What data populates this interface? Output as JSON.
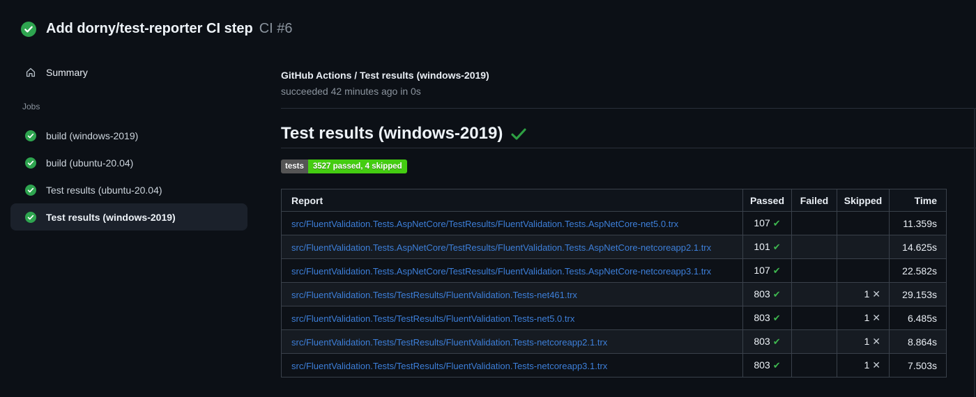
{
  "colors": {
    "page_bg": "#0c1016",
    "link": "#3d7fd9",
    "green_circle": "#2ea44f",
    "check_green": "#3fb950",
    "heading_check_green": "#2ea043",
    "badge_label_bg": "#555555",
    "badge_value_bg": "#44cc11",
    "selected_item_bg": "#1b212b"
  },
  "header": {
    "title": "Add dorny/test-reporter CI step",
    "run_number": "CI #6",
    "status_icon": "check-circle-icon"
  },
  "sidebar": {
    "summary_label": "Summary",
    "summary_icon": "home-icon",
    "jobs_section_label": "Jobs",
    "jobs": [
      {
        "label": "build (windows-2019)",
        "status": "success",
        "selected": false
      },
      {
        "label": "build (ubuntu-20.04)",
        "status": "success",
        "selected": false
      },
      {
        "label": "Test results (ubuntu-20.04)",
        "status": "success",
        "selected": false
      },
      {
        "label": "Test results (windows-2019)",
        "status": "success",
        "selected": true
      }
    ]
  },
  "main": {
    "run_title": "GitHub Actions / Test results (windows-2019)",
    "run_status": "succeeded 42 minutes ago in 0s",
    "section_title": "Test results (windows-2019)",
    "badge": {
      "label": "tests",
      "value": "3527 passed, 4 skipped"
    },
    "table": {
      "columns": [
        "Report",
        "Passed",
        "Failed",
        "Skipped",
        "Time"
      ],
      "passed_mark": "✔",
      "skipped_mark": "✕",
      "rows": [
        {
          "report": "src/FluentValidation.Tests.AspNetCore/TestResults/FluentValidation.Tests.AspNetCore-net5.0.trx",
          "passed": "107",
          "failed": "",
          "skipped": "",
          "time": "11.359s"
        },
        {
          "report": "src/FluentValidation.Tests.AspNetCore/TestResults/FluentValidation.Tests.AspNetCore-netcoreapp2.1.trx",
          "passed": "101",
          "failed": "",
          "skipped": "",
          "time": "14.625s"
        },
        {
          "report": "src/FluentValidation.Tests.AspNetCore/TestResults/FluentValidation.Tests.AspNetCore-netcoreapp3.1.trx",
          "passed": "107",
          "failed": "",
          "skipped": "",
          "time": "22.582s"
        },
        {
          "report": "src/FluentValidation.Tests/TestResults/FluentValidation.Tests-net461.trx",
          "passed": "803",
          "failed": "",
          "skipped": "1",
          "time": "29.153s"
        },
        {
          "report": "src/FluentValidation.Tests/TestResults/FluentValidation.Tests-net5.0.trx",
          "passed": "803",
          "failed": "",
          "skipped": "1",
          "time": "6.485s"
        },
        {
          "report": "src/FluentValidation.Tests/TestResults/FluentValidation.Tests-netcoreapp2.1.trx",
          "passed": "803",
          "failed": "",
          "skipped": "1",
          "time": "8.864s"
        },
        {
          "report": "src/FluentValidation.Tests/TestResults/FluentValidation.Tests-netcoreapp3.1.trx",
          "passed": "803",
          "failed": "",
          "skipped": "1",
          "time": "7.503s"
        }
      ]
    }
  }
}
